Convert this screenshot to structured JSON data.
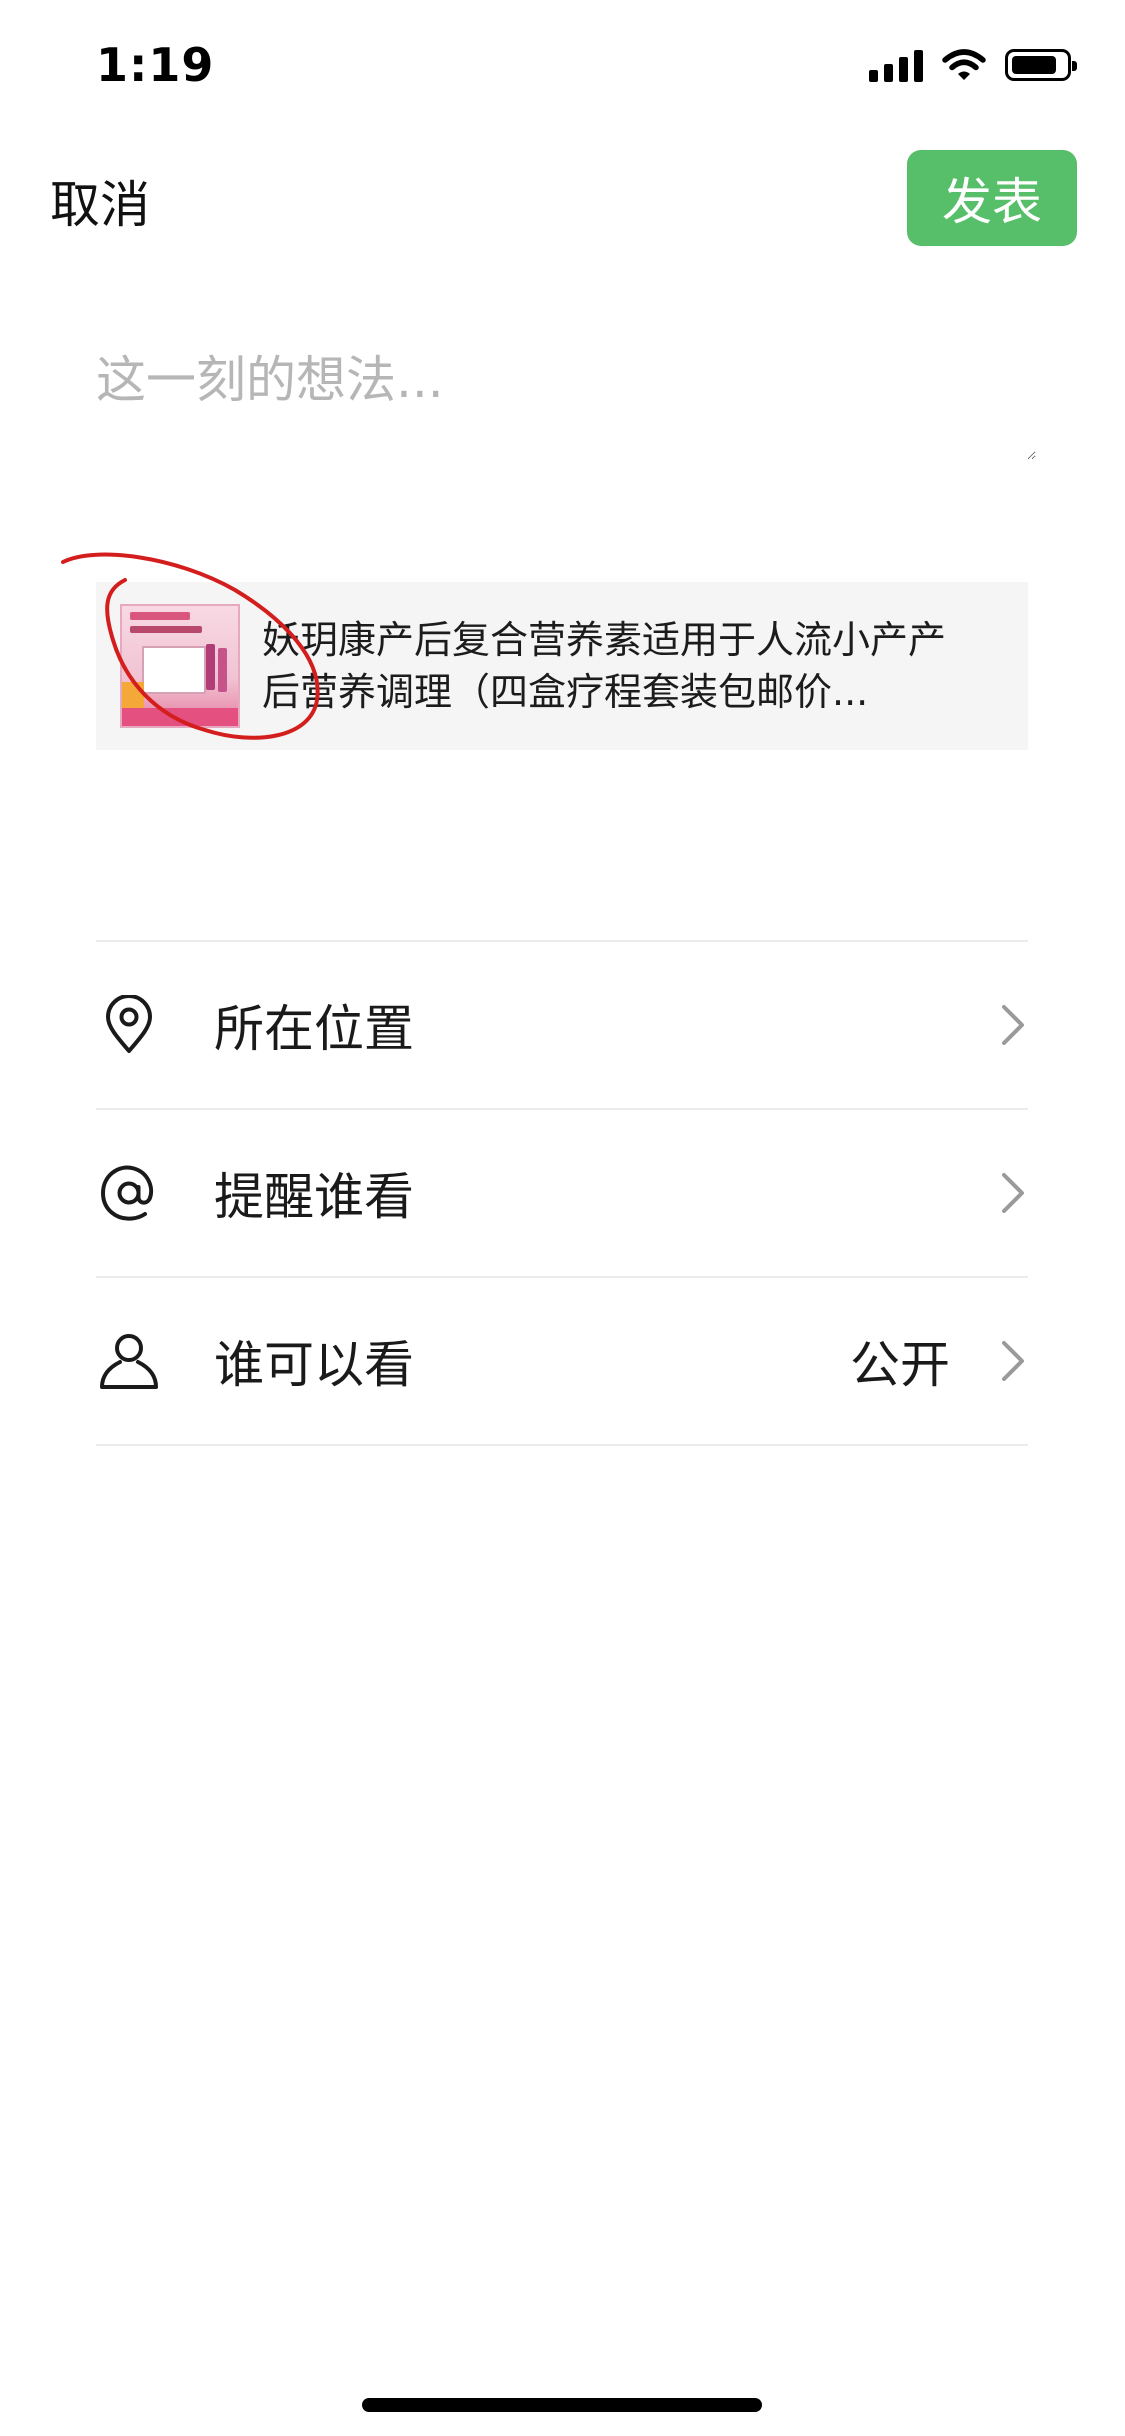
{
  "status_bar": {
    "time": "1:19",
    "icons": [
      "signal-icon",
      "wifi-icon",
      "battery-icon"
    ]
  },
  "header": {
    "cancel_label": "取消",
    "publish_label": "发表",
    "publish_color": "#57be6a"
  },
  "composer": {
    "placeholder": "这一刻的想法..."
  },
  "share_card": {
    "title": "妖玥康产后复合营养素适用于人流小产产后营养调理（四盒疗程套装包邮价..."
  },
  "options": [
    {
      "icon": "location-pin-icon",
      "label": "所在位置",
      "value": ""
    },
    {
      "icon": "at-sign-icon",
      "label": "提醒谁看",
      "value": ""
    },
    {
      "icon": "person-icon",
      "label": "谁可以看",
      "value": "公开"
    }
  ]
}
